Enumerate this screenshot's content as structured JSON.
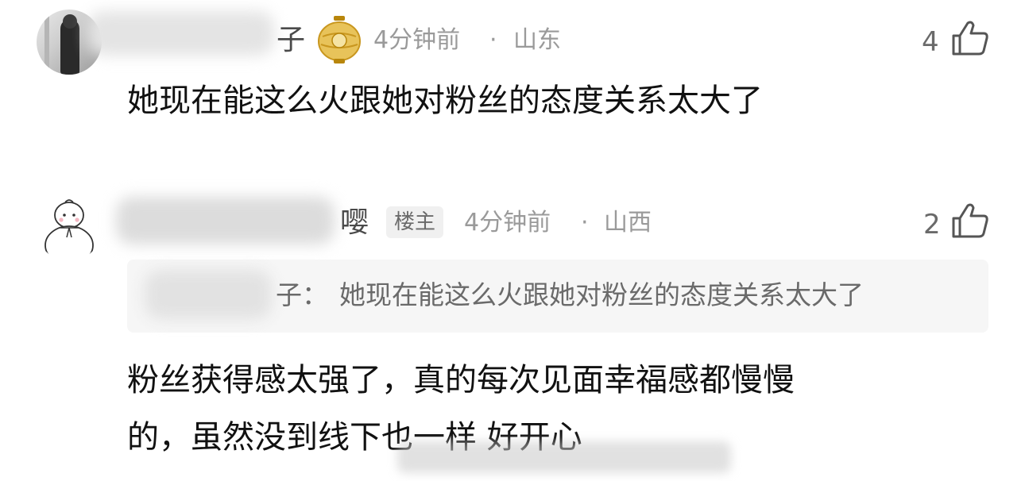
{
  "comments": [
    {
      "name_suffix": "子",
      "time": "4分钟前",
      "separator": "·",
      "location": "山东",
      "likes": "4",
      "text": "她现在能这么火跟她对粉丝的态度关系太大了"
    },
    {
      "name_suffix": "嘤",
      "badge": "楼主",
      "time": "4分钟前",
      "separator": "·",
      "location": "山西",
      "likes": "2",
      "quote": {
        "name_suffix": "子：",
        "text": "她现在能这么火跟她对粉丝的态度关系太大了"
      },
      "text_lines": [
        "粉丝获得感太强了，真的每次见面幸福感都慢慢",
        "的，虽然没到线下也一样    好开心"
      ]
    }
  ],
  "colors": {
    "meta": "#9a9a9a",
    "quote_bg": "#f6f6f6",
    "badge_bg": "#f0f0f0"
  },
  "icons": [
    "thumbs-up-icon",
    "lantern-icon",
    "snowman-avatar-icon"
  ]
}
